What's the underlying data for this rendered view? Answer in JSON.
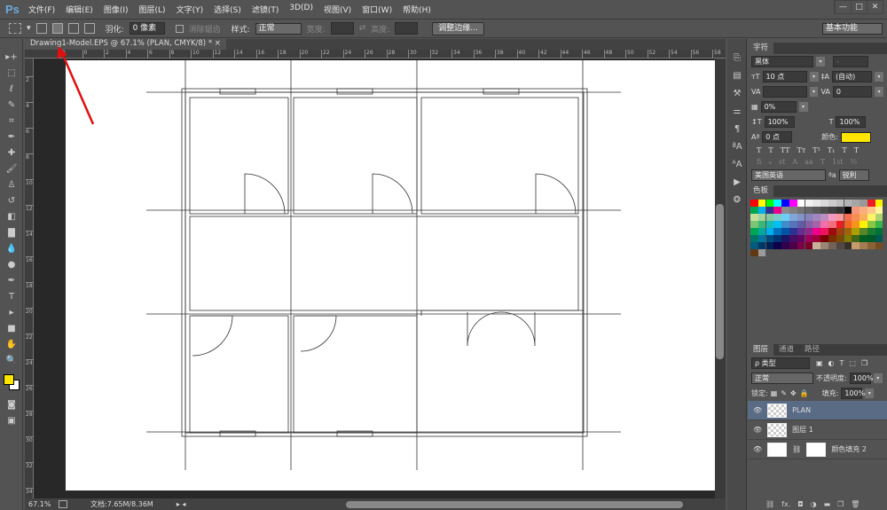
{
  "app": {
    "logo": "Ps"
  },
  "menu": [
    "文件(F)",
    "编辑(E)",
    "图像(I)",
    "图层(L)",
    "文字(Y)",
    "选择(S)",
    "滤镜(T)",
    "3D(D)",
    "视图(V)",
    "窗口(W)",
    "帮助(H)"
  ],
  "window_buttons": [
    "—",
    "□",
    "✕"
  ],
  "options": {
    "feather_label": "羽化:",
    "feather_value": "0 像素",
    "antialias_label": "消除锯齿",
    "style_label": "样式:",
    "style_value": "正常",
    "width_label": "宽度:",
    "height_label": "高度:",
    "refine_edge": "调整边缘...",
    "workspace": "基本功能"
  },
  "document": {
    "tab_title": "Drawing1-Model.EPS @ 67.1% (PLAN, CMYK/8) *",
    "close": "×"
  },
  "ruler": {
    "top": [
      "2",
      "0",
      "2",
      "4",
      "6",
      "8",
      "10",
      "12",
      "14",
      "16",
      "18",
      "20",
      "22",
      "24",
      "26",
      "28",
      "30",
      "32",
      "34",
      "36",
      "38",
      "40",
      "42",
      "44",
      "46",
      "48",
      "50",
      "52",
      "54",
      "56",
      "58"
    ],
    "left": [
      "2",
      "4",
      "6",
      "8",
      "10",
      "12",
      "14",
      "16",
      "18",
      "20",
      "22",
      "24",
      "26",
      "28",
      "30",
      "32",
      "34"
    ]
  },
  "status": {
    "zoom": "67.1%",
    "doc_info": "文档:7.65M/8.36M"
  },
  "character": {
    "tab": "字符",
    "font": "黑体",
    "font_style": "-",
    "size": "10 点",
    "leading": "(自动)",
    "kerning": "",
    "tracking": "0",
    "scale_label": "0%",
    "vscale": "100%",
    "hscale": "100%",
    "baseline": "0 点",
    "color_label": "颜色:",
    "color": "#ffe600",
    "typo_buttons": [
      "T",
      "T",
      "TT",
      "Tт",
      "T¹",
      "T₁",
      "T",
      "T"
    ],
    "ot_buttons": [
      "ﬁ",
      "ℴ",
      "st",
      "A",
      "aa",
      "T",
      "1st",
      "½"
    ],
    "language": "美国英语",
    "aa_label": "ªa",
    "aa_value": "锐利"
  },
  "swatches": {
    "tab": "色板",
    "colors": [
      "#ff0000",
      "#ffff00",
      "#00ff00",
      "#00ffff",
      "#0000ff",
      "#ff00ff",
      "#ffffff",
      "#f2f2f2",
      "#e6e6e6",
      "#d9d9d9",
      "#cccccc",
      "#bfbfbf",
      "#b3b3b3",
      "#a6a6a6",
      "#999999",
      "#ed1c24",
      "#fff200",
      "#00a651",
      "#00aeef",
      "#2e3192",
      "#ec008c",
      "#8c8c8c",
      "#808080",
      "#737373",
      "#666666",
      "#595959",
      "#4d4d4d",
      "#404040",
      "#333333",
      "#000000",
      "#f7977a",
      "#f9ad81",
      "#fdc68a",
      "#fff79a",
      "#c4df9b",
      "#a3d39c",
      "#82ca9d",
      "#7bcdc8",
      "#6ecff6",
      "#7ea7d8",
      "#8493ca",
      "#8882be",
      "#a187be",
      "#bc8dbf",
      "#f49ac2",
      "#f6989d",
      "#f26c4f",
      "#f68e55",
      "#fbaf5c",
      "#fff467",
      "#acd372",
      "#7cc576",
      "#3bb878",
      "#1abbb4",
      "#00bff3",
      "#438ccb",
      "#5574b9",
      "#605ca8",
      "#855fa8",
      "#a763a8",
      "#f06ea9",
      "#f26d7d",
      "#ed1c24",
      "#f26522",
      "#f7941d",
      "#fff200",
      "#8dc73f",
      "#39b54a",
      "#00a651",
      "#00a99d",
      "#00aeef",
      "#0072bc",
      "#0054a6",
      "#2e3192",
      "#662d91",
      "#92278f",
      "#ec008c",
      "#ed145b",
      "#9e0b0f",
      "#a0410d",
      "#a36209",
      "#aba000",
      "#598527",
      "#1a7b30",
      "#007236",
      "#00746b",
      "#0076a3",
      "#004b80",
      "#003471",
      "#1b1464",
      "#440e62",
      "#630460",
      "#9e005d",
      "#9e0039",
      "#790000",
      "#7b2e00",
      "#7d4900",
      "#827b00",
      "#406618",
      "#005e20",
      "#005826",
      "#005952",
      "#005b7f",
      "#003663",
      "#002157",
      "#0d004c",
      "#32004b",
      "#4b0049",
      "#7b0046",
      "#7a0026",
      "#c7b299",
      "#998675",
      "#736357",
      "#534741",
      "#37302a",
      "#c69c6d",
      "#a67c52",
      "#8c6239",
      "#754c24",
      "#603913",
      "#9a9a9a"
    ]
  },
  "layers": {
    "tabs": [
      "图层",
      "通道",
      "路径"
    ],
    "filter": "ρ 类型",
    "blend": "正常",
    "opacity_label": "不透明度:",
    "opacity": "100%",
    "lock_label": "锁定:",
    "fill_label": "填充:",
    "fill": "100%",
    "items": [
      {
        "name": "PLAN"
      },
      {
        "name": "图层 1"
      },
      {
        "name": "颜色填充 2"
      }
    ],
    "footer_icons": [
      "⛓",
      "fx.",
      "◘",
      "◑",
      "▬",
      "❐",
      "🗑"
    ]
  }
}
